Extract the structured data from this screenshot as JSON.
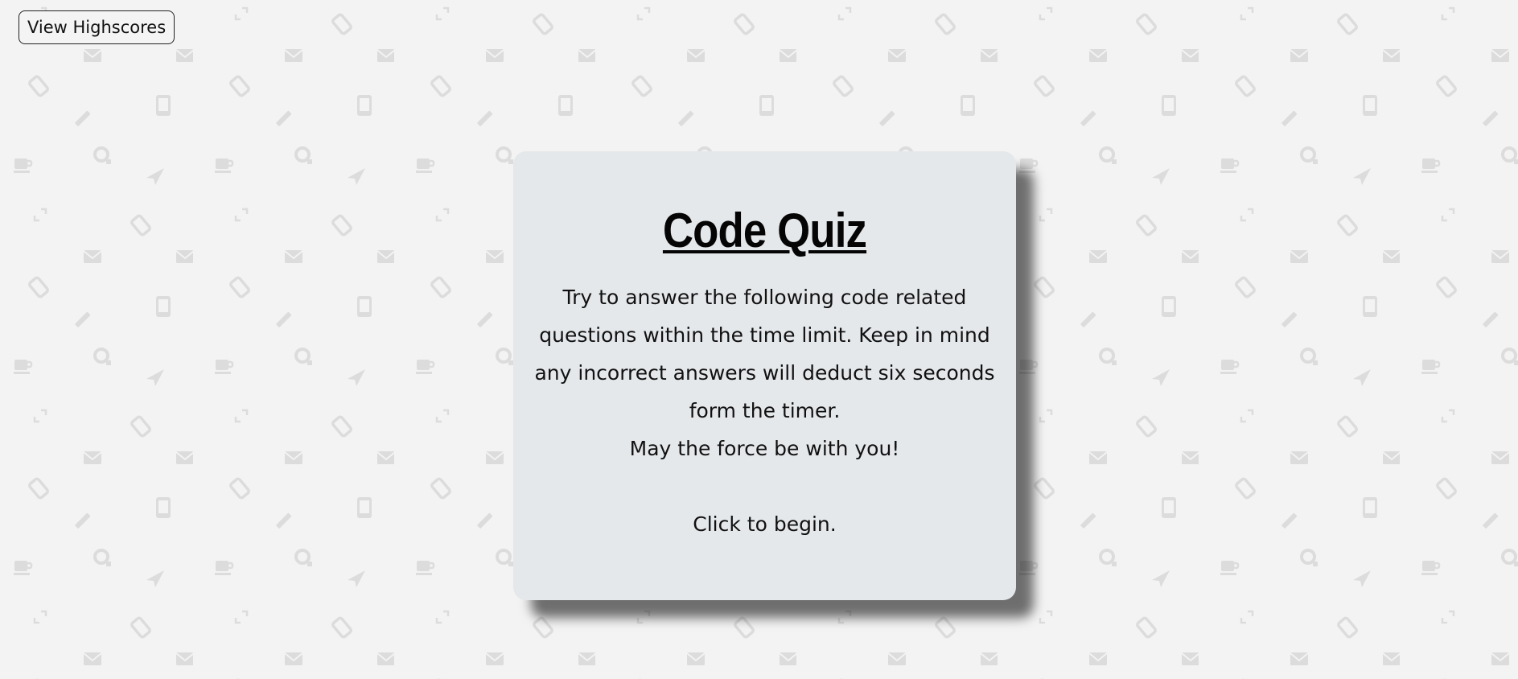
{
  "header": {
    "highscores_label": "View Highscores"
  },
  "quiz": {
    "title": "Code Quiz",
    "instructions": "Try to answer the following code related questions within the time limit. Keep in mind any incorrect answers will deduct six seconds form the timer.",
    "motto": "May the force be with you!",
    "start_label": "Click to begin."
  },
  "colors": {
    "background": "#f3f3f3",
    "card": "#e5e8eb",
    "pattern_icon": "#dcdcdc"
  },
  "background_icons": [
    "envelope-icon",
    "tablet-icon",
    "pencil-icon",
    "coffee-icon",
    "send-icon",
    "tag-icon",
    "expand-icon",
    "settings-icon"
  ]
}
